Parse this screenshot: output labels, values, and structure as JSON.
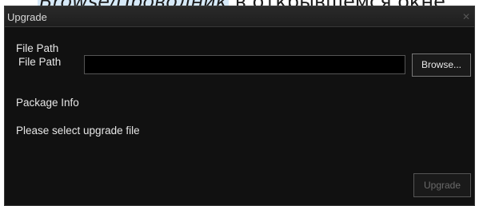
{
  "background": {
    "caption_highlight": "Browse/Проводник",
    "caption_rest": " в открывшемся окне"
  },
  "dialog": {
    "title": "Upgrade",
    "close_glyph": "✕",
    "section_file_path": "File Path",
    "field_label": "File Path",
    "file_path_value": "",
    "browse_label": "Browse...",
    "section_package_info": "Package Info",
    "status_text": "Please select upgrade file",
    "upgrade_label": "Upgrade",
    "upgrade_enabled": false
  },
  "colors": {
    "dialog_bg": "#111111",
    "input_bg": "#000000",
    "text": "#e6e6e6",
    "disabled_text": "#6a6a6a",
    "caption_highlight_bg": "#d6e9f8"
  }
}
